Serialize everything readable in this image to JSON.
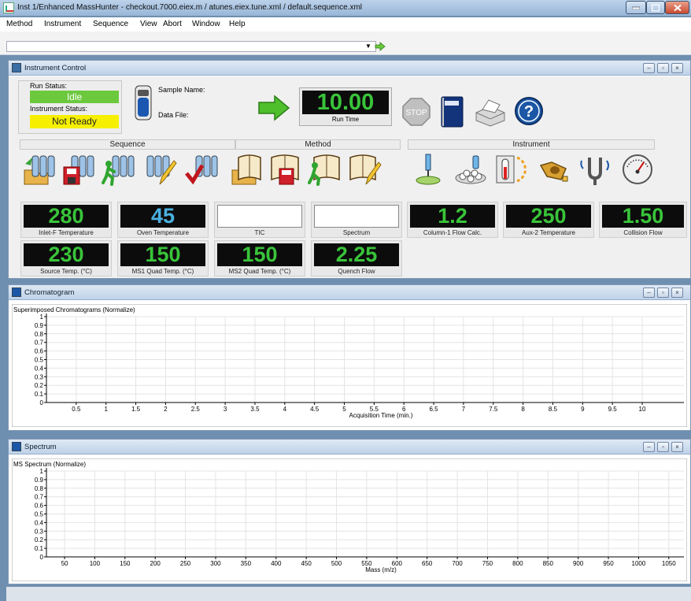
{
  "window": {
    "title": "Inst 1/Enhanced MassHunter - checkout.7000.eiex.m / atunes.eiex.tune.xml / default.sequence.xml"
  },
  "menu": [
    "Method",
    "Instrument",
    "Sequence",
    "View",
    "Abort",
    "Window",
    "Help"
  ],
  "instrument_control": {
    "title": "Instrument Control",
    "run_status_label": "Run Status:",
    "run_status_value": "Idle",
    "instrument_status_label": "Instrument Status:",
    "instrument_status_value": "Not Ready",
    "sample_name_label": "Sample Name:",
    "data_file_label": "Data File:",
    "run_time_value": "10.00",
    "run_time_label": "Run Time",
    "stop_label": "STOP",
    "help_label": "?",
    "groups": [
      "Sequence",
      "Method",
      "Instrument"
    ],
    "tiles": [
      {
        "value": "280",
        "label": "Inlet-F Temperature",
        "style": "green"
      },
      {
        "value": "45",
        "label": "Oven Temperature",
        "style": "blue"
      },
      {
        "value": "",
        "label": "TIC",
        "style": "blank"
      },
      {
        "value": "",
        "label": "Spectrum",
        "style": "blank"
      },
      {
        "value": "1.2",
        "label": "Column-1 Flow Calc.",
        "style": "green"
      },
      {
        "value": "250",
        "label": "Aux-2 Temperature",
        "style": "green"
      },
      {
        "value": "1.50",
        "label": "Collision Flow",
        "style": "green"
      },
      {
        "value": "230",
        "label": "Source Temp. (°C)",
        "style": "green"
      },
      {
        "value": "150",
        "label": "MS1 Quad Temp. (°C)",
        "style": "green"
      },
      {
        "value": "150",
        "label": "MS2 Quad Temp. (°C)",
        "style": "green"
      },
      {
        "value": "2.25",
        "label": "Quench Flow",
        "style": "green"
      }
    ],
    "colors": {
      "idle": "#6cc93e",
      "not_ready": "#f6f000",
      "display_green": "#39c43a",
      "display_blue": "#4ab0e0"
    }
  },
  "chromatogram": {
    "title": "Chromatogram",
    "chart_data": {
      "type": "line",
      "title": "Superimposed Chromatograms (Normalize)",
      "xlabel": "Acquisition Time (min.)",
      "ylabel": "",
      "xlim": [
        0,
        10.7
      ],
      "ylim": [
        0,
        1
      ],
      "x_ticks": [
        "0.5",
        "1",
        "1.5",
        "2",
        "2.5",
        "3",
        "3.5",
        "4",
        "4.5",
        "5",
        "5.5",
        "6",
        "6.5",
        "7",
        "7.5",
        "8",
        "8.5",
        "9",
        "9.5",
        "10"
      ],
      "y_ticks": [
        "0",
        "0.1",
        "0.2",
        "0.3",
        "0.4",
        "0.5",
        "0.6",
        "0.7",
        "0.8",
        "0.9",
        "1"
      ],
      "series": [],
      "grid": true
    }
  },
  "spectrum": {
    "title": "Spectrum",
    "chart_data": {
      "type": "line",
      "title": "MS Spectrum (Normalize)",
      "xlabel": "Mass (m/z)",
      "ylabel": "",
      "xlim": [
        20,
        1075
      ],
      "ylim": [
        0,
        1
      ],
      "x_ticks": [
        "50",
        "100",
        "150",
        "200",
        "250",
        "300",
        "350",
        "400",
        "450",
        "500",
        "550",
        "600",
        "650",
        "700",
        "750",
        "800",
        "850",
        "900",
        "950",
        "1000",
        "1050"
      ],
      "y_ticks": [
        "0",
        "0.1",
        "0.2",
        "0.3",
        "0.4",
        "0.5",
        "0.6",
        "0.7",
        "0.8",
        "0.9",
        "1"
      ],
      "series": [],
      "grid": true
    }
  }
}
